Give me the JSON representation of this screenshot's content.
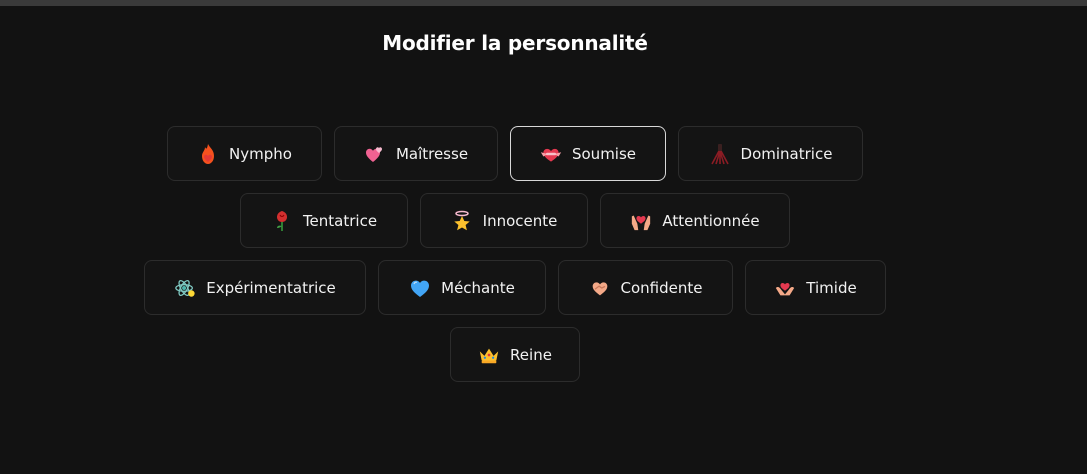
{
  "title": "Modifier la personnalité",
  "personalities": [
    {
      "label": "Nympho",
      "icon": "flame-heart-icon",
      "selected": false
    },
    {
      "label": "Maîtresse",
      "icon": "pink-hearts-icon",
      "selected": false
    },
    {
      "label": "Soumise",
      "icon": "ribbon-heart-icon",
      "selected": true
    },
    {
      "label": "Dominatrice",
      "icon": "whip-icon",
      "selected": false
    },
    {
      "label": "Tentatrice",
      "icon": "rose-icon",
      "selected": false
    },
    {
      "label": "Innocente",
      "icon": "halo-star-icon",
      "selected": false
    },
    {
      "label": "Attentionnée",
      "icon": "hands-heart-icon",
      "selected": false
    },
    {
      "label": "Expérimentatrice",
      "icon": "atom-icon",
      "selected": false
    },
    {
      "label": "Méchante",
      "icon": "blue-heart-icon",
      "selected": false
    },
    {
      "label": "Confidente",
      "icon": "handshake-icon",
      "selected": false
    },
    {
      "label": "Timide",
      "icon": "heart-hands-icon",
      "selected": false
    },
    {
      "label": "Reine",
      "icon": "crown-icon",
      "selected": false
    }
  ]
}
